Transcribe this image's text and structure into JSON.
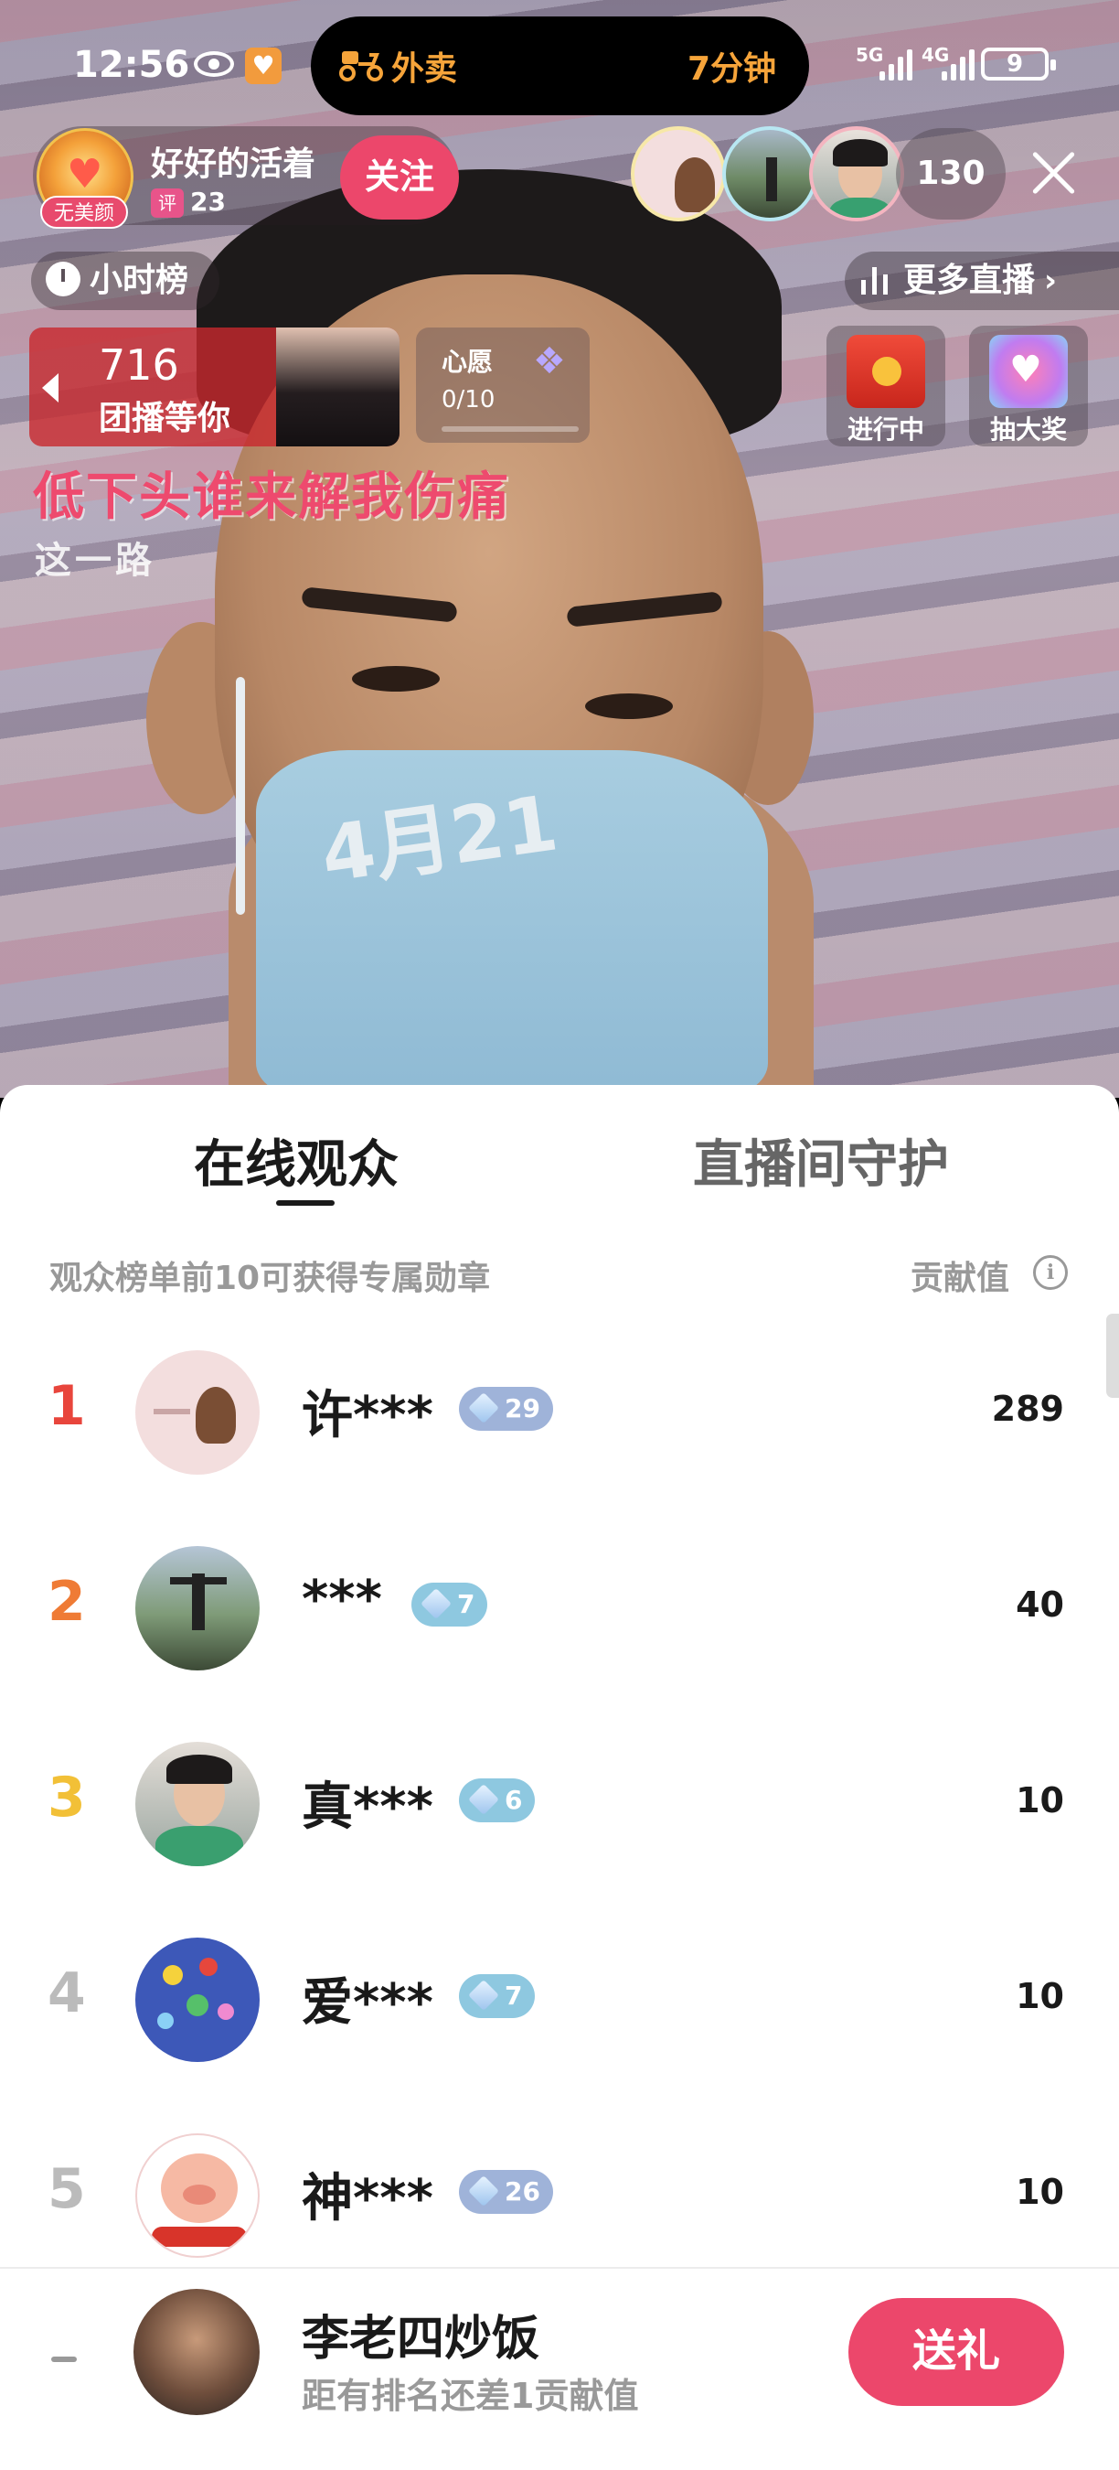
{
  "status_bar": {
    "time": "12:56",
    "island_label": "外卖",
    "island_eta": "7分钟",
    "network_1": "5G",
    "network_2": "4G",
    "battery": "9"
  },
  "host": {
    "tag": "无美颜",
    "name": "好好的活着",
    "level_label": "评",
    "level": "23",
    "follow_label": "关注"
  },
  "viewers": {
    "count": "130"
  },
  "chips": {
    "hourly_rank": "小时榜",
    "more_live": "更多直播"
  },
  "group_card": {
    "count": "716",
    "label": "团播等你"
  },
  "wish": {
    "title": "心愿",
    "progress": "0/10",
    "fraction": 0
  },
  "promos": [
    {
      "label": "进行中",
      "color": "#e83a2c"
    },
    {
      "label": "抽大奖",
      "color": "#a77cf0"
    }
  ],
  "lyrics": {
    "line1": "低下头谁来解我伤痛",
    "line2": "这一路"
  },
  "mask_text": "4月21",
  "sheet": {
    "tabs": [
      "在线观众",
      "直播间守护"
    ],
    "hint": "观众榜单前10可获得专属勋章",
    "column": "贡献值"
  },
  "rows": [
    {
      "rank": "1",
      "rank_color": "#e8453c",
      "name": "许***",
      "badge": "29",
      "badge_color": "#9fb3d9",
      "value": "289"
    },
    {
      "rank": "2",
      "rank_color": "#ef7b35",
      "name": "***",
      "badge": "7",
      "badge_color": "#8ec8e0",
      "value": "40"
    },
    {
      "rank": "3",
      "rank_color": "#f2c037",
      "name": "真***",
      "badge": "6",
      "badge_color": "#8ec8e0",
      "value": "10"
    },
    {
      "rank": "4",
      "rank_color": "#bbbbbb",
      "name": "爱***",
      "badge": "7",
      "badge_color": "#8ec8e0",
      "value": "10"
    },
    {
      "rank": "5",
      "rank_color": "#bbbbbb",
      "name": "神***",
      "badge": "26",
      "badge_color": "#9fb3d9",
      "value": "10"
    }
  ],
  "footer": {
    "name": "李老四炒饭",
    "subtitle": "距有排名还差1贡献值",
    "gift_label": "送礼"
  }
}
